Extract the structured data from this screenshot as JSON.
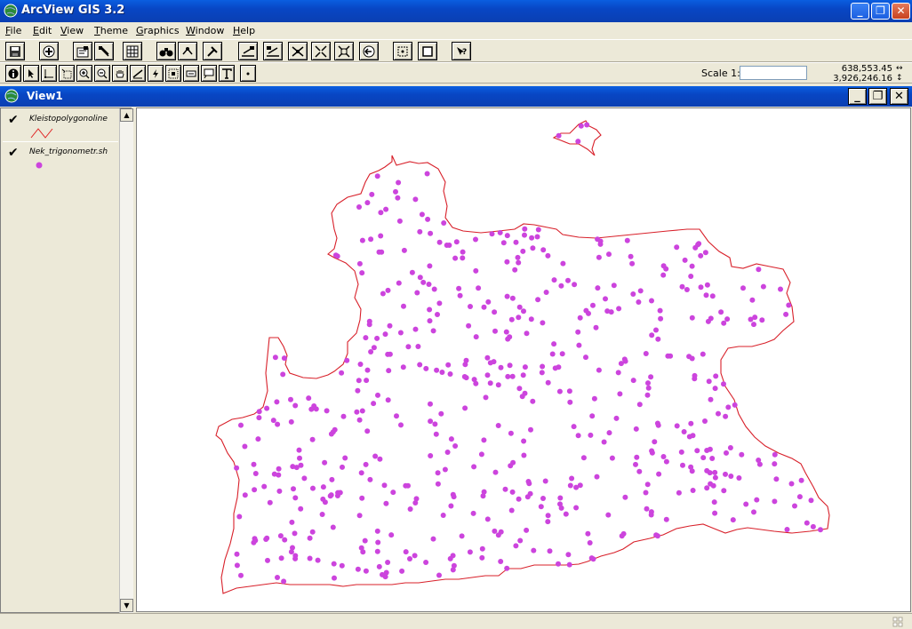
{
  "app": {
    "title": "ArcView GIS 3.2"
  },
  "menu": [
    "File",
    "Edit",
    "View",
    "Theme",
    "Graphics",
    "Window",
    "Help"
  ],
  "menu_underline": [
    "F",
    "E",
    "V",
    "T",
    "G",
    "W",
    "H"
  ],
  "scale": {
    "label": "Scale 1:",
    "value": ""
  },
  "coords": {
    "x": "638,553.45",
    "y": "3,926,246.16"
  },
  "view": {
    "title": "View1"
  },
  "themes": [
    {
      "name": "Kleistopolygonoline",
      "visible": true,
      "symbol": "line",
      "color": "#e02020"
    },
    {
      "name": "Nek_trigonometr.sh",
      "visible": true,
      "symbol": "point",
      "color": "#cc44dd"
    }
  ],
  "map": {
    "boundary_color": "#d8202a",
    "point_color": "#cc44dd"
  }
}
